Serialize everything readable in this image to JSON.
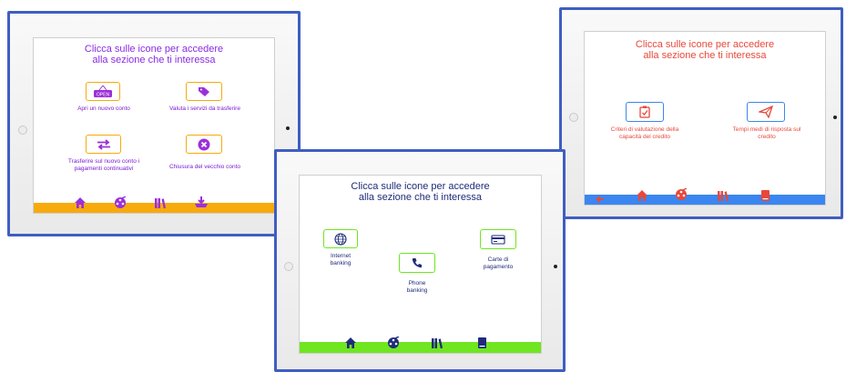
{
  "panels": {
    "left": {
      "title_line1": "Clicca sulle icone per accedere",
      "title_line2": "alla sezione che ti interessa",
      "items": [
        {
          "label_line1": "Apri un nuovo conto",
          "label_line2": "",
          "icon": "open-sign-icon",
          "badge": "OPEN"
        },
        {
          "label_line1": "Valuta i servizi da trasferire",
          "label_line2": "",
          "icon": "tag-icon"
        },
        {
          "label_line1": "Trasferire sul nuovo conto i",
          "label_line2": "pagamenti continuativi",
          "icon": "transfer-arrows-icon"
        },
        {
          "label_line1": "Chiusura del vecchio conto",
          "label_line2": "",
          "icon": "close-circle-icon"
        }
      ],
      "nav_icons": [
        "home-icon",
        "reel-icon",
        "books-icon",
        "download-icon"
      ],
      "colors": {
        "accent": "#f7aa0c",
        "text": "#7a1bd0",
        "title": "#8a2be2"
      }
    },
    "middle": {
      "title_line1": "Clicca sulle icone per accedere",
      "title_line2": "alla sezione che ti interessa",
      "items": [
        {
          "label_line1": "Internet",
          "label_line2": "banking",
          "icon": "globe-icon"
        },
        {
          "label_line1": "Phone",
          "label_line2": "banking",
          "icon": "phone-icon"
        },
        {
          "label_line1": "Carte di",
          "label_line2": "pagamento",
          "icon": "card-icon"
        }
      ],
      "nav_icons": [
        "home-icon",
        "reel-icon",
        "books-icon",
        "book-icon"
      ],
      "colors": {
        "accent": "#6fe620",
        "text": "#1f2b7a",
        "title": "#1f2b7a"
      }
    },
    "right": {
      "title_line1": "Clicca sulle icone per accedere",
      "title_line2": "alla sezione che ti interessa",
      "items": [
        {
          "label_line1": "Criteri di valutazione della",
          "label_line2": "capacità del credito",
          "icon": "clipboard-check-icon"
        },
        {
          "label_line1": "Tempi medi di risposta sul",
          "label_line2": "credito",
          "icon": "paper-plane-icon"
        }
      ],
      "nav_icons": [
        "back-arrow-icon",
        "home-icon",
        "reel-icon",
        "books-icon",
        "book-icon"
      ],
      "colors": {
        "accent": "#3b86f0",
        "text": "#e8483a",
        "title": "#e8483a"
      }
    }
  }
}
